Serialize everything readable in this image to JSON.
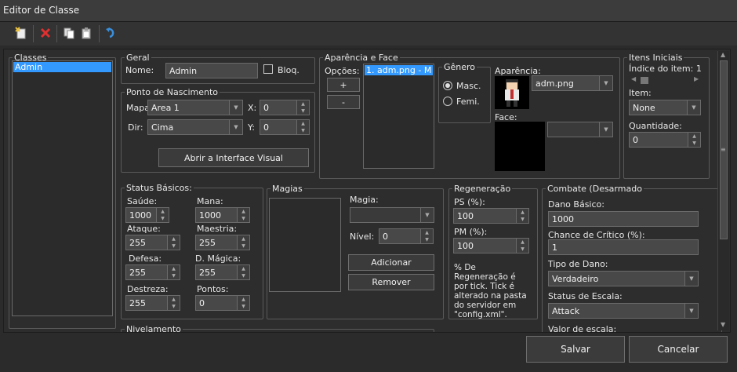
{
  "window": {
    "title": "Editor de Classe"
  },
  "toolbar": {
    "icons": [
      "new-icon",
      "delete-icon",
      "copy-icon",
      "paste-icon",
      "undo-icon"
    ]
  },
  "classes": {
    "title": "Classes",
    "items": [
      "Admin"
    ]
  },
  "geral": {
    "title": "Geral",
    "name_label": "Nome:",
    "name_value": "Admin",
    "lock_label": "Bloq."
  },
  "spawn": {
    "title": "Ponto de Nascimento",
    "map_label": "Mapa",
    "map_value": "Area 1",
    "x_label": "X:",
    "x_value": "0",
    "dir_label": "Dir:",
    "dir_value": "Cima",
    "y_label": "Y:",
    "y_value": "0",
    "visual_button": "Abrir a Interface Visual"
  },
  "appearance": {
    "title": "Aparência e Face",
    "options_label": "Opções:",
    "add_button": "+",
    "remove_button": "-",
    "list_items": [
      "1. adm.png - M"
    ],
    "gender_title": "Gênero",
    "male": "Masc.",
    "female": "Femi.",
    "sprite_label": "Aparência:",
    "sprite_value": "adm.png",
    "face_label": "Face:",
    "face_value": ""
  },
  "items": {
    "title": "Itens Iniciais",
    "index_label": "Índice do item: 1",
    "item_label": "Item:",
    "item_value": "None",
    "qty_label": "Quantidade:",
    "qty_value": "0"
  },
  "stats": {
    "title": "Status Básicos:",
    "hp_label": "Saúde:",
    "hp_value": "1000",
    "mp_label": "Mana:",
    "mp_value": "1000",
    "atk_label": "Ataque:",
    "atk_value": "255",
    "mastery_label": "Maestria:",
    "mastery_value": "255",
    "def_label": "Defesa:",
    "def_value": "255",
    "mdef_label": "D. Mágica:",
    "mdef_value": "255",
    "dex_label": "Destreza:",
    "dex_value": "255",
    "points_label": "Pontos:",
    "points_value": "0"
  },
  "leveling": {
    "title": "Nivelamento"
  },
  "magic": {
    "title": "Magias",
    "magic_label": "Magia:",
    "magic_value": "",
    "level_label": "Nível:",
    "level_value": "0",
    "add_button": "Adicionar",
    "remove_button": "Remover"
  },
  "regen": {
    "title": "Regeneração",
    "hp_label": "PS (%):",
    "hp_value": "100",
    "mp_label": "PM (%):",
    "mp_value": "100",
    "note": "% De Regeneração é por tick. Tick é alterado na pasta do servidor em \"config.xml\"."
  },
  "combat": {
    "title": "Combate (Desarmado",
    "base_damage_label": "Dano Básico:",
    "base_damage_value": "1000",
    "crit_label": "Chance de Crítico (%):",
    "crit_value": "1",
    "damage_type_label": "Tipo de Dano:",
    "damage_type_value": "Verdadeiro",
    "scaling_label": "Status de Escala:",
    "scaling_value": "Attack",
    "scale_value_label": "Valor de escala:"
  },
  "footer": {
    "save_button": "Salvar",
    "cancel_button": "Cancelar"
  },
  "colors": {
    "selection": "#3399ff",
    "background": "#2d2d2d"
  }
}
